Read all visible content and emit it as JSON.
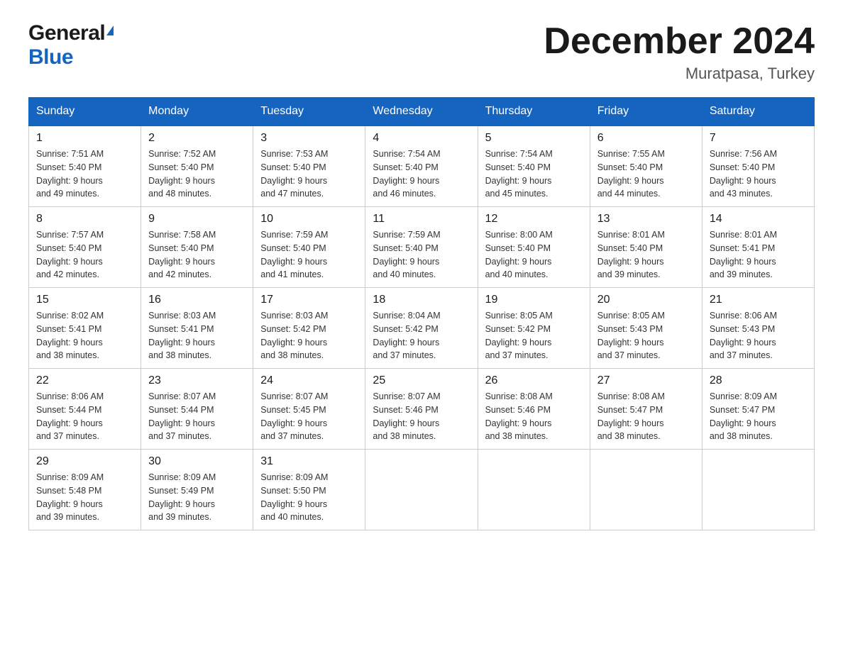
{
  "header": {
    "logo_general": "General",
    "logo_blue": "Blue",
    "month_title": "December 2024",
    "location": "Muratpasa, Turkey"
  },
  "days_of_week": [
    "Sunday",
    "Monday",
    "Tuesday",
    "Wednesday",
    "Thursday",
    "Friday",
    "Saturday"
  ],
  "weeks": [
    [
      {
        "day": "1",
        "info": "Sunrise: 7:51 AM\nSunset: 5:40 PM\nDaylight: 9 hours\nand 49 minutes."
      },
      {
        "day": "2",
        "info": "Sunrise: 7:52 AM\nSunset: 5:40 PM\nDaylight: 9 hours\nand 48 minutes."
      },
      {
        "day": "3",
        "info": "Sunrise: 7:53 AM\nSunset: 5:40 PM\nDaylight: 9 hours\nand 47 minutes."
      },
      {
        "day": "4",
        "info": "Sunrise: 7:54 AM\nSunset: 5:40 PM\nDaylight: 9 hours\nand 46 minutes."
      },
      {
        "day": "5",
        "info": "Sunrise: 7:54 AM\nSunset: 5:40 PM\nDaylight: 9 hours\nand 45 minutes."
      },
      {
        "day": "6",
        "info": "Sunrise: 7:55 AM\nSunset: 5:40 PM\nDaylight: 9 hours\nand 44 minutes."
      },
      {
        "day": "7",
        "info": "Sunrise: 7:56 AM\nSunset: 5:40 PM\nDaylight: 9 hours\nand 43 minutes."
      }
    ],
    [
      {
        "day": "8",
        "info": "Sunrise: 7:57 AM\nSunset: 5:40 PM\nDaylight: 9 hours\nand 42 minutes."
      },
      {
        "day": "9",
        "info": "Sunrise: 7:58 AM\nSunset: 5:40 PM\nDaylight: 9 hours\nand 42 minutes."
      },
      {
        "day": "10",
        "info": "Sunrise: 7:59 AM\nSunset: 5:40 PM\nDaylight: 9 hours\nand 41 minutes."
      },
      {
        "day": "11",
        "info": "Sunrise: 7:59 AM\nSunset: 5:40 PM\nDaylight: 9 hours\nand 40 minutes."
      },
      {
        "day": "12",
        "info": "Sunrise: 8:00 AM\nSunset: 5:40 PM\nDaylight: 9 hours\nand 40 minutes."
      },
      {
        "day": "13",
        "info": "Sunrise: 8:01 AM\nSunset: 5:40 PM\nDaylight: 9 hours\nand 39 minutes."
      },
      {
        "day": "14",
        "info": "Sunrise: 8:01 AM\nSunset: 5:41 PM\nDaylight: 9 hours\nand 39 minutes."
      }
    ],
    [
      {
        "day": "15",
        "info": "Sunrise: 8:02 AM\nSunset: 5:41 PM\nDaylight: 9 hours\nand 38 minutes."
      },
      {
        "day": "16",
        "info": "Sunrise: 8:03 AM\nSunset: 5:41 PM\nDaylight: 9 hours\nand 38 minutes."
      },
      {
        "day": "17",
        "info": "Sunrise: 8:03 AM\nSunset: 5:42 PM\nDaylight: 9 hours\nand 38 minutes."
      },
      {
        "day": "18",
        "info": "Sunrise: 8:04 AM\nSunset: 5:42 PM\nDaylight: 9 hours\nand 37 minutes."
      },
      {
        "day": "19",
        "info": "Sunrise: 8:05 AM\nSunset: 5:42 PM\nDaylight: 9 hours\nand 37 minutes."
      },
      {
        "day": "20",
        "info": "Sunrise: 8:05 AM\nSunset: 5:43 PM\nDaylight: 9 hours\nand 37 minutes."
      },
      {
        "day": "21",
        "info": "Sunrise: 8:06 AM\nSunset: 5:43 PM\nDaylight: 9 hours\nand 37 minutes."
      }
    ],
    [
      {
        "day": "22",
        "info": "Sunrise: 8:06 AM\nSunset: 5:44 PM\nDaylight: 9 hours\nand 37 minutes."
      },
      {
        "day": "23",
        "info": "Sunrise: 8:07 AM\nSunset: 5:44 PM\nDaylight: 9 hours\nand 37 minutes."
      },
      {
        "day": "24",
        "info": "Sunrise: 8:07 AM\nSunset: 5:45 PM\nDaylight: 9 hours\nand 37 minutes."
      },
      {
        "day": "25",
        "info": "Sunrise: 8:07 AM\nSunset: 5:46 PM\nDaylight: 9 hours\nand 38 minutes."
      },
      {
        "day": "26",
        "info": "Sunrise: 8:08 AM\nSunset: 5:46 PM\nDaylight: 9 hours\nand 38 minutes."
      },
      {
        "day": "27",
        "info": "Sunrise: 8:08 AM\nSunset: 5:47 PM\nDaylight: 9 hours\nand 38 minutes."
      },
      {
        "day": "28",
        "info": "Sunrise: 8:09 AM\nSunset: 5:47 PM\nDaylight: 9 hours\nand 38 minutes."
      }
    ],
    [
      {
        "day": "29",
        "info": "Sunrise: 8:09 AM\nSunset: 5:48 PM\nDaylight: 9 hours\nand 39 minutes."
      },
      {
        "day": "30",
        "info": "Sunrise: 8:09 AM\nSunset: 5:49 PM\nDaylight: 9 hours\nand 39 minutes."
      },
      {
        "day": "31",
        "info": "Sunrise: 8:09 AM\nSunset: 5:50 PM\nDaylight: 9 hours\nand 40 minutes."
      },
      {
        "day": "",
        "info": ""
      },
      {
        "day": "",
        "info": ""
      },
      {
        "day": "",
        "info": ""
      },
      {
        "day": "",
        "info": ""
      }
    ]
  ]
}
